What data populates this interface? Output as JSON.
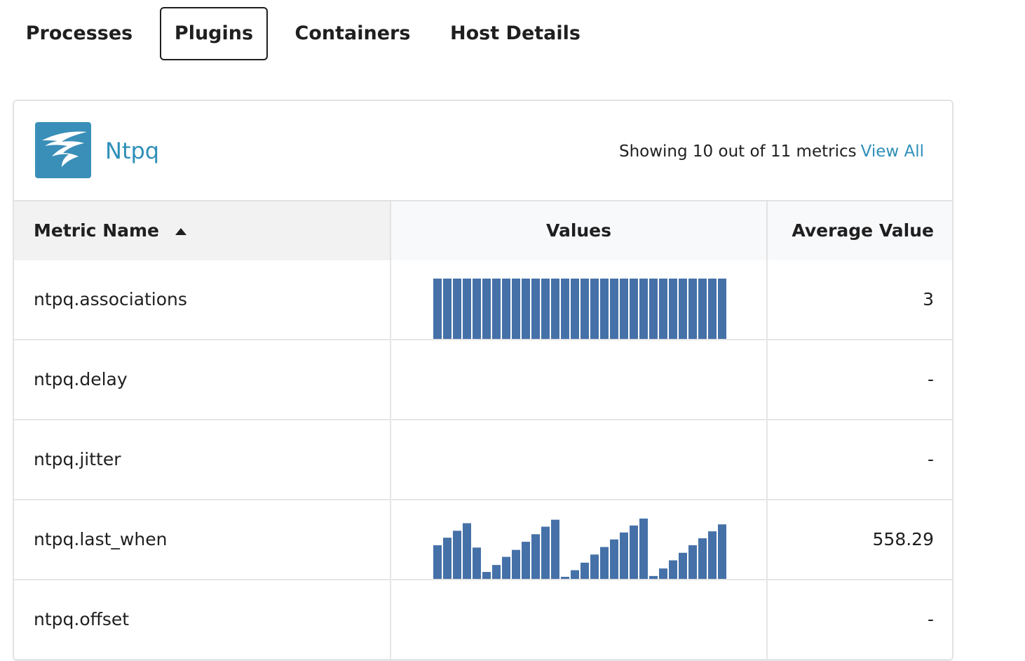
{
  "tabs": [
    {
      "label": "Processes",
      "active": false
    },
    {
      "label": "Plugins",
      "active": true
    },
    {
      "label": "Containers",
      "active": false
    },
    {
      "label": "Host Details",
      "active": false
    }
  ],
  "plugin": {
    "name": "Ntpq",
    "logo_icon": "solarwinds-logo-icon",
    "logo_color": "#3a8fb8",
    "summary": "Showing 10 out of 11 metrics",
    "view_all_label": "View All",
    "accent_color": "#2f8fb8"
  },
  "table": {
    "columns": {
      "name": "Metric Name",
      "values": "Values",
      "average": "Average Value"
    },
    "sort": {
      "column": "name",
      "direction": "ascending",
      "icon": "sort-ascending-icon"
    },
    "bar_color": "#4571a8",
    "rows": [
      {
        "metric": "ntpq.associations",
        "average": "3",
        "values": [
          3,
          3,
          3,
          3,
          3,
          3,
          3,
          3,
          3,
          3,
          3,
          3,
          3,
          3,
          3,
          3,
          3,
          3,
          3,
          3,
          3,
          3,
          3,
          3,
          3,
          3,
          3,
          3,
          3,
          3
        ]
      },
      {
        "metric": "ntpq.delay",
        "average": "-",
        "values": []
      },
      {
        "metric": "ntpq.jitter",
        "average": "-",
        "values": []
      },
      {
        "metric": "ntpq.last_when",
        "average": "558.29",
        "values": [
          580,
          710,
          830,
          960,
          540,
          120,
          240,
          380,
          500,
          640,
          770,
          900,
          1020,
          20,
          150,
          280,
          420,
          550,
          680,
          800,
          920,
          1040,
          50,
          180,
          320,
          450,
          580,
          700,
          820,
          940
        ]
      },
      {
        "metric": "ntpq.offset",
        "average": "-",
        "values": []
      }
    ]
  }
}
